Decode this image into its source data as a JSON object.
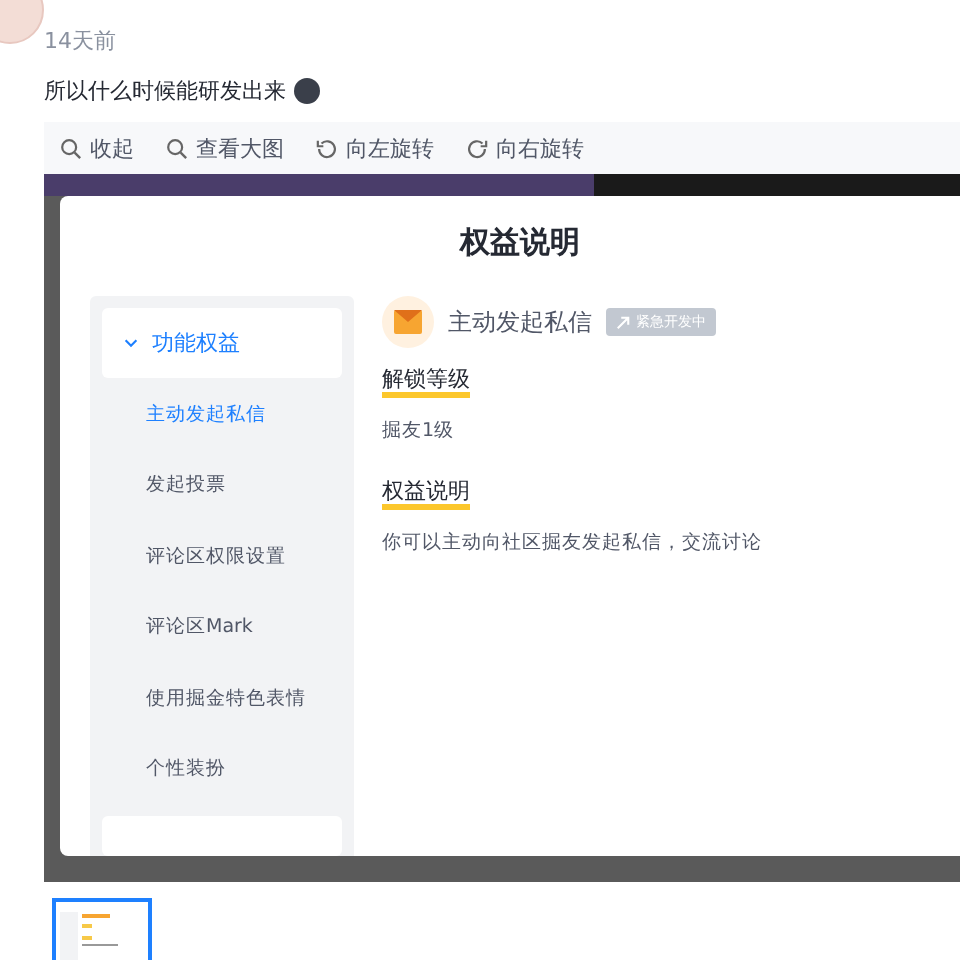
{
  "post": {
    "time": "14天前",
    "text": "所以什么时候能研发出来"
  },
  "toolbar": [
    {
      "label": "收起",
      "kind": "zoom"
    },
    {
      "label": "查看大图",
      "kind": "zoom"
    },
    {
      "label": "向左旋转",
      "kind": "rotateleft"
    },
    {
      "label": "向右旋转",
      "kind": "rotateright"
    }
  ],
  "dialog": {
    "title": "权益说明",
    "sidebar": [
      {
        "label": "功能权益",
        "expanded": true,
        "children": [
          {
            "label": "主动发起私信",
            "selected": true
          },
          {
            "label": "发起投票",
            "selected": false
          },
          {
            "label": "评论区权限设置",
            "selected": false
          },
          {
            "label": "评论区Mark",
            "selected": false
          },
          {
            "label": "使用掘金特色表情",
            "selected": false
          },
          {
            "label": "个性装扮",
            "selected": false
          }
        ]
      }
    ],
    "content": {
      "title": "主动发起私信",
      "badge": "紧急开发中",
      "sections": [
        {
          "heading": "解锁等级",
          "body": "掘友1级"
        },
        {
          "heading": "权益说明",
          "body": "你可以主动向社区掘友发起私信，交流讨论"
        }
      ]
    }
  },
  "thumbnails": [
    {
      "selected": true
    }
  ]
}
